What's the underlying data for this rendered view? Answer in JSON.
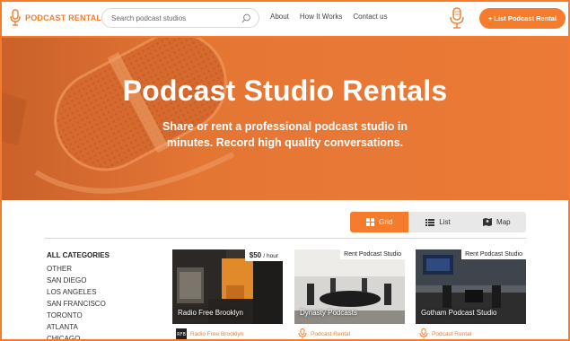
{
  "brand": {
    "name": "PODCAST RENTAL",
    "accent": "#f47c2c"
  },
  "search": {
    "placeholder": "Search podcast studios"
  },
  "nav": [
    {
      "label": "About"
    },
    {
      "label": "How It Works"
    },
    {
      "label": "Contact us"
    }
  ],
  "header": {
    "cta_label": "+ List Podcast Rental",
    "mic_icon": "microphone-icon"
  },
  "hero": {
    "title": "Podcast Studio Rentals",
    "subtitle_line1": "Share or rent a professional podcast studio in",
    "subtitle_line2": "minutes. Record high quality conversations."
  },
  "view_toggle": {
    "options": [
      {
        "label": "Grid",
        "icon": "grid-icon",
        "active": true
      },
      {
        "label": "List",
        "icon": "list-icon",
        "active": false
      },
      {
        "label": "Map",
        "icon": "map-icon",
        "active": false
      }
    ]
  },
  "categories": {
    "title": "ALL CATEGORIES",
    "items": [
      "OTHER",
      "SAN DIEGO",
      "LOS ANGELES",
      "SAN FRANCISCO",
      "TORONTO",
      "ATLANTA",
      "CHICAGO"
    ]
  },
  "listings": [
    {
      "name": "Radio Free Brooklyn",
      "price": "$50",
      "price_unit": "/ hour",
      "host": "Radio Free Brooklyn"
    },
    {
      "name": "Dynasty Podcasts",
      "badge": "Rent Podcast Studio",
      "host": "Podcast Rental"
    },
    {
      "name": "Gotham Podcast Studio",
      "badge": "Rent Podcast Studio",
      "host": "Podcast Rental"
    }
  ]
}
